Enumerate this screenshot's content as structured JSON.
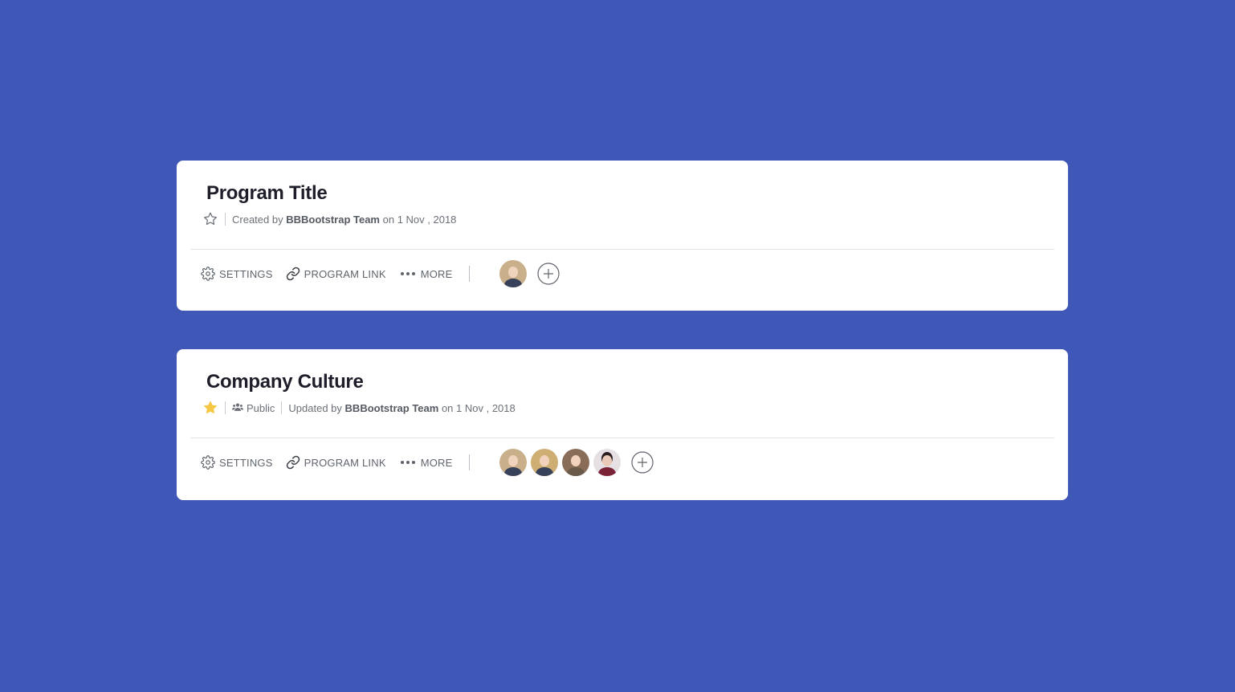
{
  "cards": [
    {
      "title": "Program Title",
      "starred": false,
      "meta": {
        "prefix": "Created by",
        "author": "BBBootstrap Team",
        "date": "on 1 Nov , 2018"
      },
      "actions": {
        "settings": "SETTINGS",
        "program_link": "PROGRAM LINK",
        "more": "MORE"
      },
      "members": [
        "member-avatar"
      ]
    },
    {
      "title": "Company Culture",
      "starred": true,
      "visibility": "Public",
      "meta": {
        "prefix": "Updated by",
        "author": "BBBootstrap Team",
        "date": "on 1 Nov , 2018"
      },
      "actions": {
        "settings": "SETTINGS",
        "program_link": "PROGRAM LINK",
        "more": "MORE"
      },
      "members": [
        "member-avatar",
        "member-avatar",
        "member-avatar",
        "member-avatar"
      ]
    }
  ],
  "colors": {
    "background": "#3f57b7",
    "card": "#ffffff",
    "star_active": "#f6c744",
    "star_inactive": "#6b7078",
    "text_muted": "#6b7078"
  },
  "icons": {
    "star": "star-icon",
    "settings": "gear-icon",
    "link": "link-icon",
    "more": "ellipsis-icon",
    "public": "users-icon",
    "add": "plus-circle-icon"
  }
}
